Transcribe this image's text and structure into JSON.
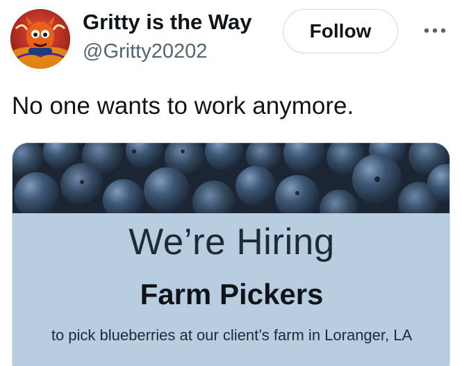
{
  "author": {
    "display_name": "Gritty is the Way",
    "handle": "@Gritty20202",
    "avatar_icon": "gritty-mascot-avatar"
  },
  "actions": {
    "follow_label": "Follow",
    "more_icon": "more-horizontal-icon"
  },
  "tweet": {
    "text": "No one wants to work anymore."
  },
  "media": {
    "image_subject": "blueberries",
    "headline": "We’re Hiring",
    "subheadline": "Farm Pickers",
    "description": "to pick blueberries at our client’s farm in Loranger, LA",
    "colors": {
      "panel_background": "#b8cde0",
      "berry_blue": "#3d5673"
    }
  }
}
